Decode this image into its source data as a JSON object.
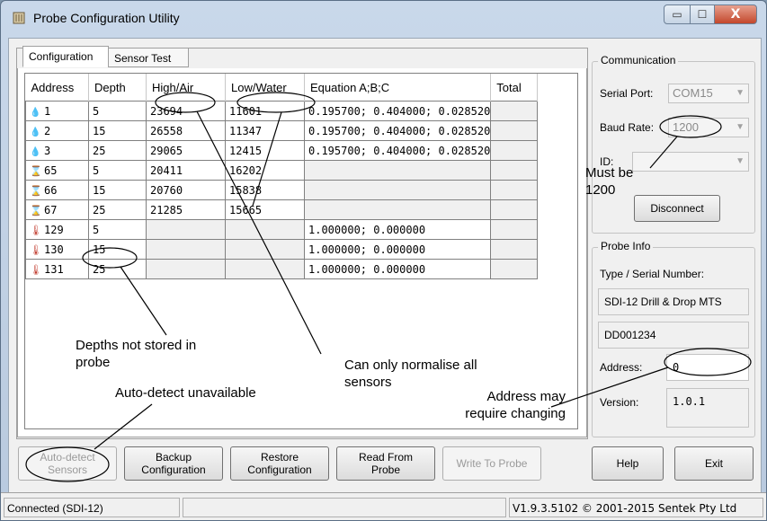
{
  "window": {
    "title": "Probe Configuration Utility",
    "icon": "probe-app-icon",
    "min_glyph": "▭",
    "max_glyph": "☐",
    "close_glyph": "X"
  },
  "tabs": [
    {
      "label": "Configuration",
      "active": true
    },
    {
      "label": "Sensor Test",
      "active": false
    }
  ],
  "table": {
    "columns": [
      "Address",
      "Depth",
      "High/Air",
      "Low/Water",
      "Equation  A;B;C",
      "Total"
    ],
    "rows": [
      {
        "icon": "water-drop-icon",
        "address": "1",
        "depth": "5",
        "high": "23694",
        "low": "11601",
        "equation": "0.195700; 0.404000; 0.028520",
        "total": ""
      },
      {
        "icon": "water-drop-icon",
        "address": "2",
        "depth": "15",
        "high": "26558",
        "low": "11347",
        "equation": "0.195700; 0.404000; 0.028520",
        "total": ""
      },
      {
        "icon": "water-drop-icon",
        "address": "3",
        "depth": "25",
        "high": "29065",
        "low": "12415",
        "equation": "0.195700; 0.404000; 0.028520",
        "total": ""
      },
      {
        "icon": "hourglass-icon",
        "address": "65",
        "depth": "5",
        "high": "20411",
        "low": "16202",
        "equation": "",
        "total": ""
      },
      {
        "icon": "hourglass-icon",
        "address": "66",
        "depth": "15",
        "high": "20760",
        "low": "15838",
        "equation": "",
        "total": ""
      },
      {
        "icon": "hourglass-icon",
        "address": "67",
        "depth": "25",
        "high": "21285",
        "low": "15665",
        "equation": "",
        "total": ""
      },
      {
        "icon": "thermometer-icon",
        "address": "129",
        "depth": "5",
        "high": "",
        "low": "",
        "equation": "1.000000; 0.000000",
        "total": ""
      },
      {
        "icon": "thermometer-icon",
        "address": "130",
        "depth": "15",
        "high": "",
        "low": "",
        "equation": "1.000000; 0.000000",
        "total": ""
      },
      {
        "icon": "thermometer-icon",
        "address": "131",
        "depth": "25",
        "high": "",
        "low": "",
        "equation": "1.000000; 0.000000",
        "total": ""
      }
    ]
  },
  "communication": {
    "title": "Communication",
    "serial_port_label": "Serial Port:",
    "serial_port_value": "COM15",
    "baud_rate_label": "Baud Rate:",
    "baud_rate_value": "1200",
    "id_label": "ID:",
    "id_value": "",
    "disconnect_label": "Disconnect"
  },
  "probe_info": {
    "title": "Probe Info",
    "type_label": "Type / Serial Number:",
    "type_value": "SDI-12 Drill & Drop MTS",
    "serial_value": "DD001234",
    "address_label": "Address:",
    "address_value": "0",
    "version_label": "Version:",
    "version_value": "1.0.1"
  },
  "buttons": {
    "auto_detect": "Auto-detect Sensors",
    "backup": "Backup Configuration",
    "restore": "Restore Configuration",
    "read": "Read From Probe",
    "write": "Write To Probe",
    "help": "Help",
    "exit": "Exit"
  },
  "status": {
    "left": "Connected (SDI-12)",
    "right": "V1.9.3.5102 © 2001-2015 Sentek Pty Ltd"
  },
  "annotations": {
    "must_be": "Must be 1200",
    "depths": "Depths not stored in probe",
    "auto_detect": "Auto-detect unavailable",
    "normalise": "Can only normalise all sensors",
    "address": "Address may require changing"
  }
}
